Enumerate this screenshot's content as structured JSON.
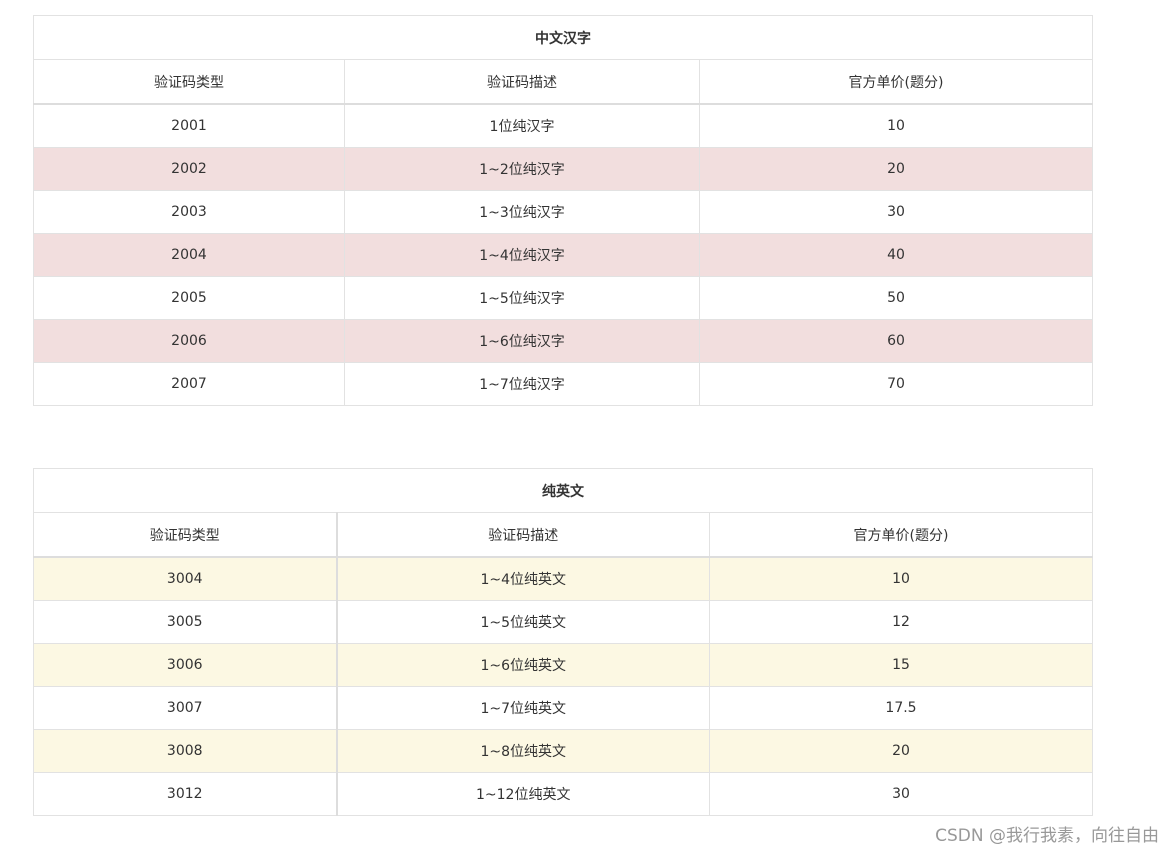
{
  "colors": {
    "chinese_stripe": "#f2dede",
    "english_stripe": "#fcf8e3",
    "border": "#e2e2e2"
  },
  "tables": [
    {
      "title": "中文汉字",
      "headers": [
        "验证码类型",
        "验证码描述",
        "官方单价(题分)"
      ],
      "rows": [
        [
          "2001",
          "1位纯汉字",
          "10"
        ],
        [
          "2002",
          "1~2位纯汉字",
          "20"
        ],
        [
          "2003",
          "1~3位纯汉字",
          "30"
        ],
        [
          "2004",
          "1~4位纯汉字",
          "40"
        ],
        [
          "2005",
          "1~5位纯汉字",
          "50"
        ],
        [
          "2006",
          "1~6位纯汉字",
          "60"
        ],
        [
          "2007",
          "1~7位纯汉字",
          "70"
        ]
      ]
    },
    {
      "title": "纯英文",
      "headers": [
        "验证码类型",
        "验证码描述",
        "官方单价(题分)"
      ],
      "rows": [
        [
          "3004",
          "1~4位纯英文",
          "10"
        ],
        [
          "3005",
          "1~5位纯英文",
          "12"
        ],
        [
          "3006",
          "1~6位纯英文",
          "15"
        ],
        [
          "3007",
          "1~7位纯英文",
          "17.5"
        ],
        [
          "3008",
          "1~8位纯英文",
          "20"
        ],
        [
          "3012",
          "1~12位纯英文",
          "30"
        ]
      ]
    }
  ],
  "watermark": "CSDN @我行我素，向往自由"
}
